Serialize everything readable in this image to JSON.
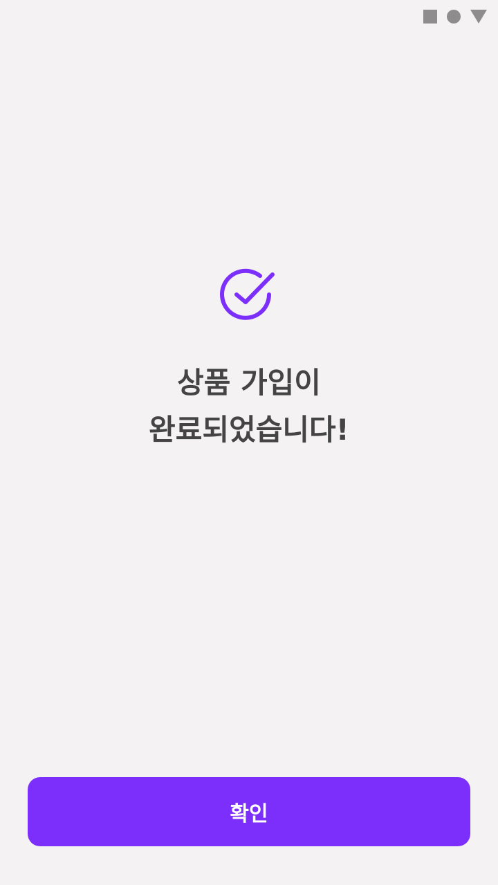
{
  "status_bar": {
    "icons": [
      "square-icon",
      "circle-icon",
      "triangle-down-icon"
    ],
    "icon_color": "#8e8c8d"
  },
  "result": {
    "icon": "check-circle-icon",
    "icon_color": "#7c2ffb",
    "message_line1": "상품 가입이",
    "message_line2": "완료되었습니다!"
  },
  "footer": {
    "confirm_label": "확인",
    "button_color": "#7c2ffb"
  }
}
